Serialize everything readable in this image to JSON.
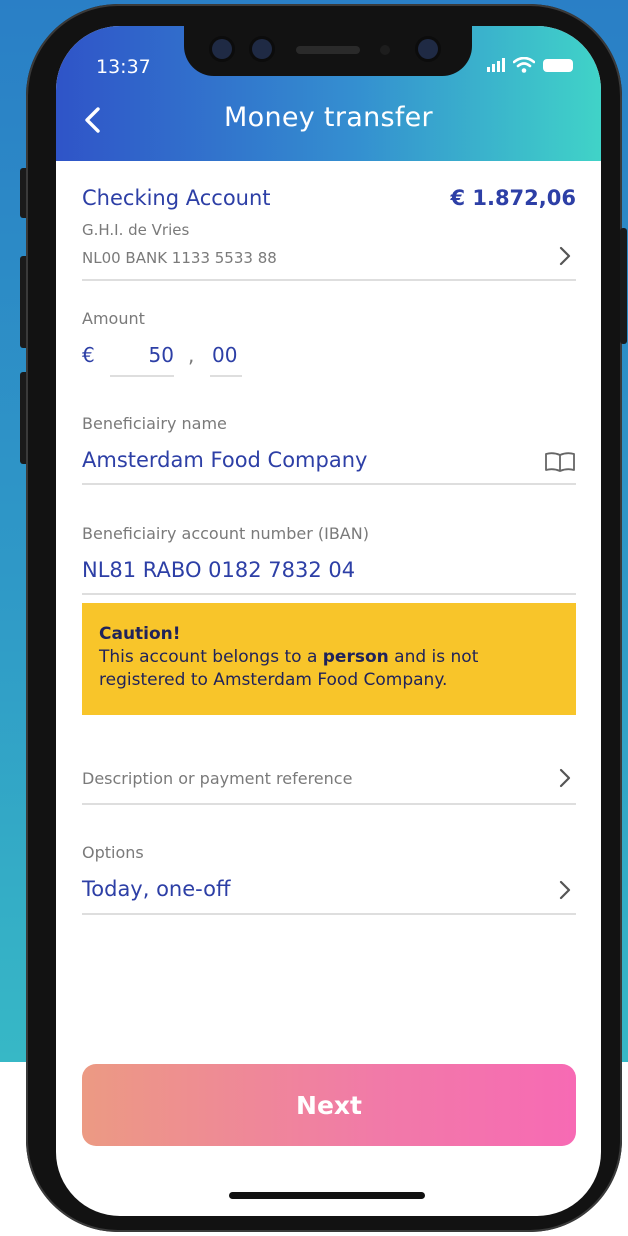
{
  "status_bar": {
    "time": "13:37"
  },
  "header": {
    "title": "Money transfer"
  },
  "account": {
    "name": "Checking Account",
    "balance": "€ 1.872,06",
    "holder": "G.H.I. de Vries",
    "iban": "NL00 BANK 1133 5533 88"
  },
  "amount": {
    "label": "Amount",
    "currency": "€",
    "whole": "50",
    "separator": ",",
    "cents": "00"
  },
  "beneficiary_name": {
    "label": "Beneficiairy name",
    "value": "Amsterdam Food Company",
    "icon": "address-book-icon"
  },
  "beneficiary_iban": {
    "label": "Beneficiairy account number (IBAN)",
    "value": "NL81 RABO 0182 7832 04"
  },
  "caution": {
    "title": "Caution!",
    "text_before": "This account belongs to a ",
    "text_bold": "person",
    "text_after": " and is not registered to Amsterdam Food Company."
  },
  "description": {
    "placeholder": "Description or payment reference"
  },
  "options": {
    "label": "Options",
    "value": "Today, one-off"
  },
  "next_button": {
    "label": "Next"
  },
  "colors": {
    "accent_blue": "#2d3fa6",
    "caution_yellow": "#f8c52a",
    "button_gradient_start": "#ec9a83",
    "button_gradient_end": "#f76ab4"
  }
}
